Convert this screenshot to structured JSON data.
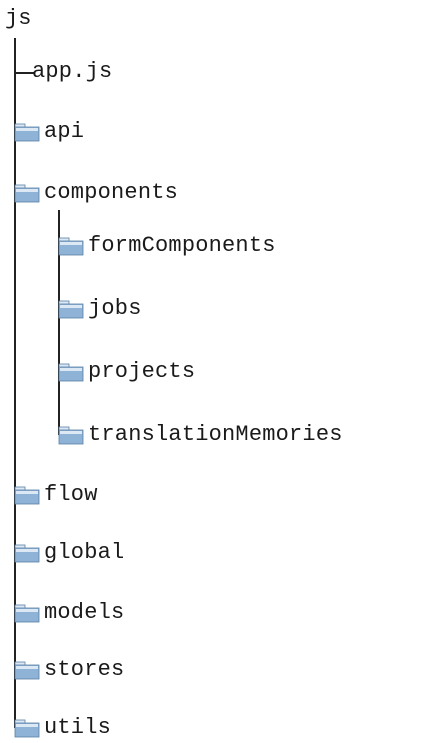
{
  "tree": {
    "root": "js",
    "file": "app.js",
    "folders": [
      "api",
      "components",
      "flow",
      "global",
      "models",
      "stores",
      "utils"
    ],
    "components_children": [
      "formComponents",
      "jobs",
      "projects",
      "translationMemories"
    ]
  },
  "colors": {
    "folder_top": "#dce9f5",
    "folder_body": "#8fb3d6",
    "folder_edge": "#5b7fa6",
    "line": "#222222"
  },
  "icons": {
    "folder": "folder-icon"
  }
}
